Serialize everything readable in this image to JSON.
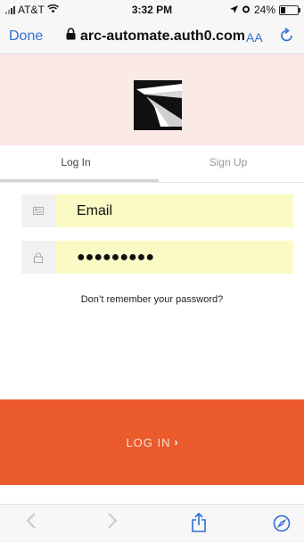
{
  "status_bar": {
    "carrier": "AT&T",
    "time": "3:32 PM",
    "battery_percent": "24%"
  },
  "browser": {
    "done_label": "Done",
    "url": "arc-automate.auth0.com",
    "text_size_label": "AA",
    "reload_icon": "reload-icon",
    "accent_color": "#2f6fd6"
  },
  "tabs": {
    "login_label": "Log In",
    "signup_label": "Sign Up",
    "active": "Log In"
  },
  "form": {
    "email_value": "Email",
    "password_value": "●●●●●●●●●",
    "forgot_label": "Don’t remember your password?",
    "field_bg_color": "#fafac5"
  },
  "login_button": {
    "label": "LOG IN",
    "chevron": "›",
    "color": "#ea5a2a"
  },
  "hero": {
    "background": "#fbe9e5"
  }
}
